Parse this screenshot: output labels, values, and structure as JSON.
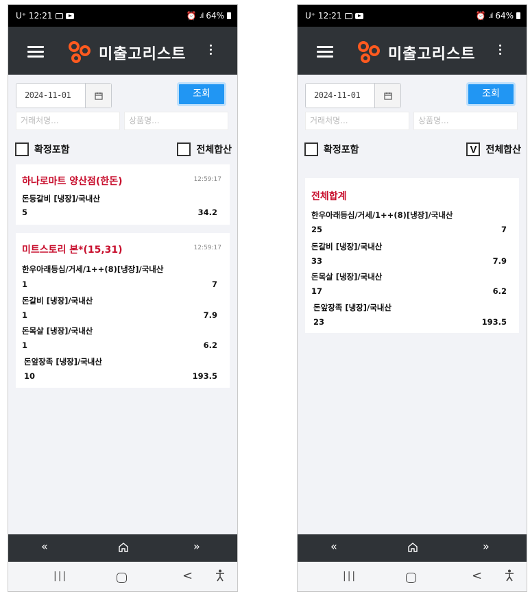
{
  "status": {
    "time": "U⁺ 12:21",
    "signal": "ℛ",
    "battery": "64%"
  },
  "header": {
    "title": "미출고리스트"
  },
  "filters": {
    "date": "2024-11-01",
    "search_label": "조회",
    "client_placeholder": "거래처명...",
    "product_placeholder": "상품명...",
    "confirm_label": "확정포함",
    "total_label": "전체합산"
  },
  "left_screen": {
    "confirm_checked": "",
    "total_checked": "",
    "cards": [
      {
        "title": "하나로마트 양산점(한돈)",
        "time": "12:59:17",
        "items": [
          {
            "name": "돈등갈비 [냉장]/국내산",
            "qty": "5",
            "amount": "34.2"
          }
        ]
      },
      {
        "title": "미트스토리 본*(15,31)",
        "time": "12:59:17",
        "items": [
          {
            "name": "한우아래등심/거세/1++(8)[냉장]/국내산",
            "qty": "1",
            "amount": "7"
          },
          {
            "name": "돈갈비 [냉장]/국내산",
            "qty": "1",
            "amount": "7.9"
          },
          {
            "name": "돈목살 [냉장]/국내산",
            "qty": "1",
            "amount": "6.2"
          },
          {
            "name": "돈앞장족 [냉장]/국내산",
            "qty": "10",
            "amount": "193.5"
          }
        ]
      }
    ]
  },
  "right_screen": {
    "confirm_checked": "",
    "total_checked": "V",
    "cards": [
      {
        "title": "전체합계",
        "items": [
          {
            "name": "한우아래등심/거세/1++(8)[냉장]/국내산",
            "qty": "25",
            "amount": "7"
          },
          {
            "name": "돈갈비 [냉장]/국내산",
            "qty": "33",
            "amount": "7.9"
          },
          {
            "name": "돈목살 [냉장]/국내산",
            "qty": "17",
            "amount": "6.2"
          },
          {
            "name": "돈앞장족 [냉장]/국내산",
            "qty": "23",
            "amount": "193.5"
          }
        ]
      }
    ]
  },
  "bottom_nav": {
    "prev": "«",
    "home": "⌂",
    "next": "»"
  },
  "system_nav": {
    "recent": "|||",
    "back": "<"
  },
  "colors": {
    "accent": "#2196f3",
    "header_bg": "#2f3337",
    "title_red": "#c8102e",
    "logo": "#ff5a1f"
  }
}
